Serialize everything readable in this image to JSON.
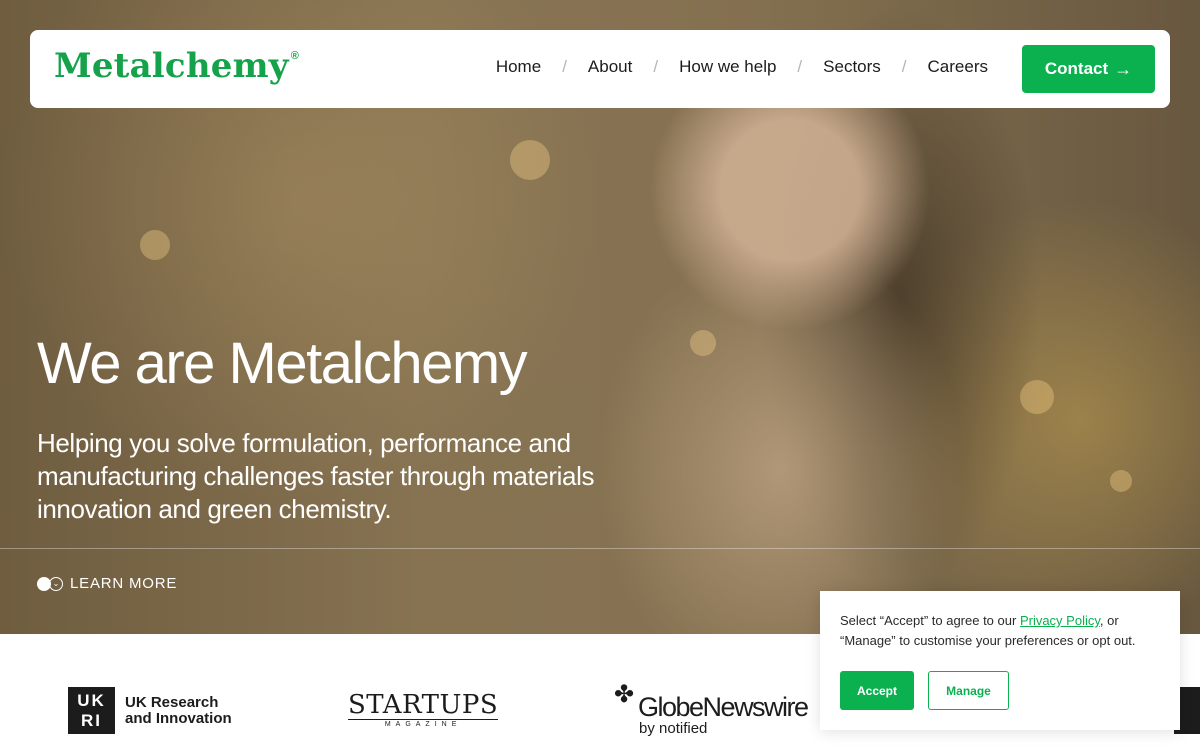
{
  "brand": {
    "name": "Metalchemy",
    "registered": "®",
    "color": "#14a24a"
  },
  "nav": {
    "items": [
      "Home",
      "About",
      "How we help",
      "Sectors",
      "Careers"
    ],
    "separator": "/",
    "contact_label": "Contact",
    "contact_icon": "arrow-right-icon",
    "accent": "#0bb04f"
  },
  "hero": {
    "title": "We are Metalchemy",
    "subtitle": "Helping you solve formulation, performance and manufacturing challenges faster through materials innovation and green chemistry.",
    "learn_more": "LEARN MORE"
  },
  "logos": {
    "ukri": {
      "mark_top": "UK",
      "mark_bottom": "RI",
      "text": "UK Research and Innovation"
    },
    "startups": {
      "name": "STARTUPS",
      "sub": "MAGAZINE"
    },
    "globe": {
      "name": "GlobeNewswire",
      "sub": "by notified"
    }
  },
  "cookie": {
    "text_before": "Select “Accept” to agree to our ",
    "link": "Privacy Policy",
    "text_after": ", or “Manage” to customise your preferences or opt out.",
    "accept_label": "Accept",
    "manage_label": "Manage"
  }
}
